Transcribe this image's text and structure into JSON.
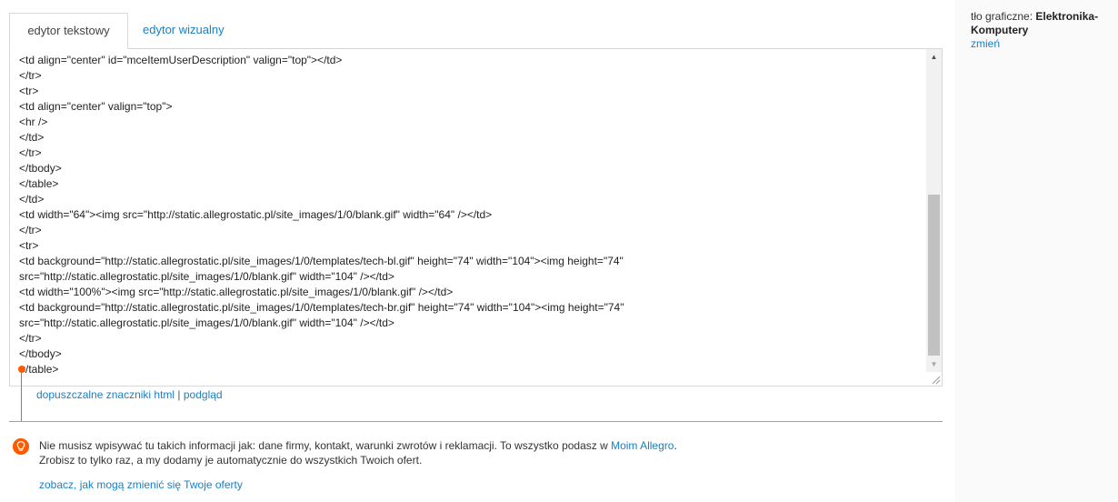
{
  "tabs": {
    "text_editor": "edytor tekstowy",
    "visual_editor": "edytor wizualny"
  },
  "editor": {
    "code_lines": [
      "<td align=\"center\" id=\"mceItemUserDescription\" valign=\"top\"></td>",
      "</tr>",
      "<tr>",
      "<td align=\"center\" valign=\"top\">",
      "<hr />",
      "</td>",
      "</tr>",
      "</tbody>",
      "</table>",
      "</td>",
      "<td width=\"64\"><img src=\"http://static.allegrostatic.pl/site_images/1/0/blank.gif\" width=\"64\" /></td>",
      "</tr>",
      "<tr>",
      "<td background=\"http://static.allegrostatic.pl/site_images/1/0/templates/tech-bl.gif\" height=\"74\" width=\"104\"><img height=\"74\"",
      "src=\"http://static.allegrostatic.pl/site_images/1/0/blank.gif\" width=\"104\" /></td>",
      "<td width=\"100%\"><img src=\"http://static.allegrostatic.pl/site_images/1/0/blank.gif\" /></td>",
      "<td background=\"http://static.allegrostatic.pl/site_images/1/0/templates/tech-br.gif\" height=\"74\" width=\"104\"><img height=\"74\"",
      "src=\"http://static.allegrostatic.pl/site_images/1/0/blank.gif\" width=\"104\" /></td>",
      "</tr>",
      "</tbody>",
      "</table>"
    ]
  },
  "links": {
    "allowed_tags": "dopuszczalne znaczniki html",
    "separator": " | ",
    "preview": "podgląd"
  },
  "info": {
    "text_before": "Nie musisz wpisywać tu takich informacji jak: dane firmy, kontakt, warunki zwrotów i reklamacji. To wszystko podasz w ",
    "link": "Moim Allegro",
    "text_after": ".",
    "line2": "Zrobisz to tylko raz, a my dodamy je automatycznie do wszystkich Twoich ofert.",
    "more_link": "zobacz, jak mogą zmienić się Twoje oferty",
    "icon": "lightbulb-icon"
  },
  "background": {
    "label": "tło graficzne: ",
    "value": "Elektronika-Komputery",
    "change": "zmień"
  },
  "colors": {
    "accent": "#ff5a00",
    "link": "#1a80c2"
  }
}
